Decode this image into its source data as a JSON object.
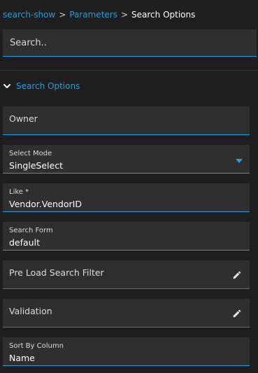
{
  "breadcrumb": {
    "items": [
      "search-show",
      "Parameters",
      "Search Options"
    ],
    "separator": ">"
  },
  "search": {
    "placeholder": "Search.."
  },
  "section": {
    "title": "Search Options",
    "expanded": true
  },
  "fields": {
    "owner": {
      "placeholder": "Owner"
    },
    "select_mode": {
      "label": "Select Mode",
      "value": "SingleSelect"
    },
    "like": {
      "label": "Like *",
      "value": "Vendor.VendorID"
    },
    "search_form": {
      "label": "Search Form",
      "value": "default"
    },
    "pre_load_search_filter": {
      "placeholder": "Pre Load Search Filter"
    },
    "validation": {
      "placeholder": "Validation"
    },
    "sort_by_column": {
      "label": "Sort By Column",
      "value": "Name"
    }
  },
  "icons": {
    "section_toggle": "chevron-down-icon",
    "select_mode_arrow": "dropdown-arrow-icon",
    "pre_load_edit": "pencil-icon",
    "validation_edit": "pencil-icon"
  },
  "colors": {
    "background": "#1e1e1e",
    "field_background": "#2f2f2f",
    "accent": "#2b9bd8",
    "text": "#ffffff"
  }
}
